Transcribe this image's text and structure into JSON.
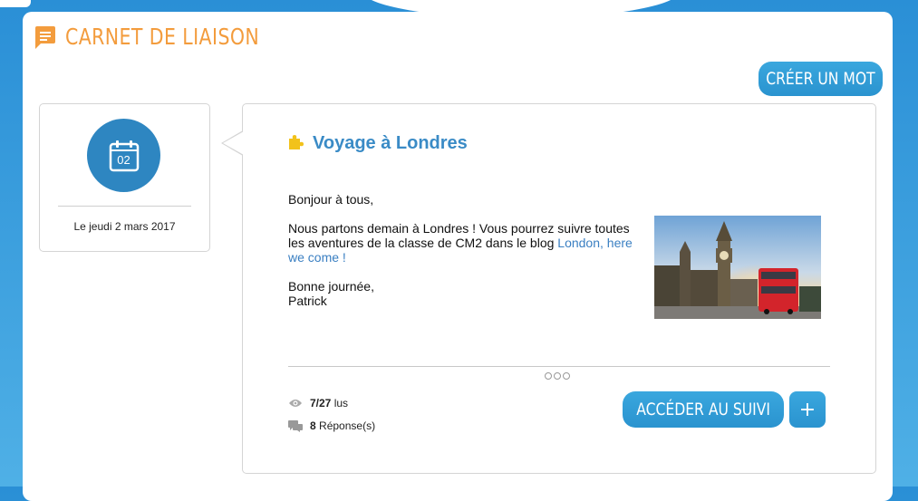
{
  "header": {
    "title": "CARNET DE LIAISON",
    "create_button": "CRÉER UN MOT"
  },
  "date_card": {
    "day_number": "02",
    "date_label": "Le jeudi 2 mars 2017"
  },
  "post": {
    "title": "Voyage à Londres",
    "greeting": "Bonjour à tous,",
    "body_text": "Nous partons demain à Londres ! Vous pourrez suivre toutes les aventures de la classe de CM2 dans le blog ",
    "link_text": "London, here we come !",
    "closing": "Bonne journée,",
    "signature": "Patrick",
    "stats": {
      "read_count": "7/27",
      "read_label": "lus",
      "reply_count": "8",
      "reply_label": "Réponse(s)"
    },
    "follow_button": "ACCÉDER AU SUIVI",
    "plus_button": "+"
  },
  "icons": {
    "header": "chat-bubble-icon",
    "date": "calendar-icon",
    "post": "puzzle-icon",
    "read": "eye-icon",
    "reply": "comments-icon",
    "more": "more-dots-icon"
  },
  "colors": {
    "accent_orange": "#f39c3d",
    "primary_blue": "#2e86c1",
    "title_blue": "#3a8bc6",
    "link_blue": "#3a7fc2"
  }
}
